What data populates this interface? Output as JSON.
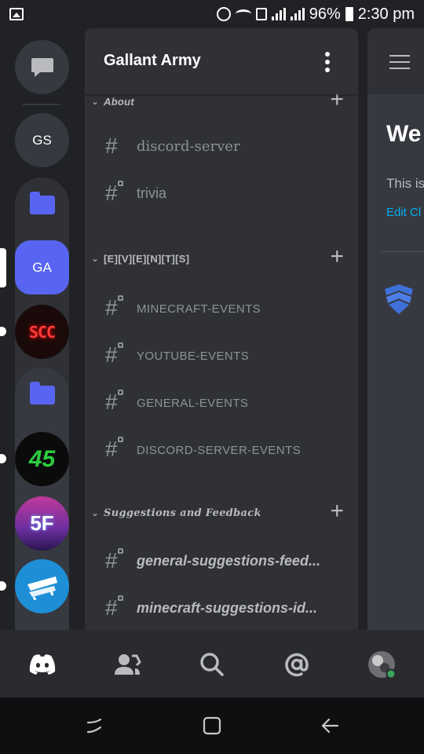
{
  "status_bar": {
    "battery": "96%",
    "time": "2:30 pm"
  },
  "server_rail": {
    "servers": [
      {
        "name": "direct-messages",
        "icon": "chat-bubble-icon"
      },
      {
        "name": "gs",
        "label": "GS"
      },
      {
        "name": "folder-1",
        "icon": "folder-icon"
      },
      {
        "name": "ga",
        "label": "GA",
        "selected": true
      },
      {
        "name": "scc",
        "label": "SCC"
      },
      {
        "name": "folder-2",
        "icon": "folder-icon"
      },
      {
        "name": "45",
        "label": "45"
      },
      {
        "name": "5f",
        "label": "5F"
      },
      {
        "name": "bench",
        "icon": "bench-icon"
      }
    ]
  },
  "channel_panel": {
    "server_name": "Gallant Army",
    "categories": [
      {
        "label": "About",
        "channels": [
          {
            "name": "discord-server",
            "locked": false
          },
          {
            "name": "trivia",
            "locked": true
          }
        ]
      },
      {
        "label": "[E][V][E][N][T][S]",
        "channels": [
          {
            "name": "MINECRAFT-EVENTS",
            "locked": true
          },
          {
            "name": "YOUTUBE-EVENTS",
            "locked": true
          },
          {
            "name": "GENERAL-EVENTS",
            "locked": true
          },
          {
            "name": "DISCORD-SERVER-EVENTS",
            "locked": true
          }
        ]
      },
      {
        "label": "Suggestions and Feedback",
        "channels": [
          {
            "name": "general-suggestions-feed...",
            "locked": true
          },
          {
            "name": "minecraft-suggestions-id...",
            "locked": true
          }
        ]
      }
    ]
  },
  "preview": {
    "title": "We",
    "text": "This is",
    "link": "Edit Cl"
  },
  "bottom_nav": [
    {
      "name": "home",
      "icon": "discord-logo-icon",
      "active": true
    },
    {
      "name": "friends",
      "icon": "friends-icon"
    },
    {
      "name": "search",
      "icon": "search-icon"
    },
    {
      "name": "mentions",
      "icon": "at-icon"
    },
    {
      "name": "profile",
      "icon": "avatar-icon"
    }
  ],
  "colors": {
    "accent": "#5865f2",
    "bg_dark": "#202225",
    "panel": "#2f3136",
    "chat": "#36393f",
    "online": "#3ba55d",
    "link": "#00aff4"
  }
}
